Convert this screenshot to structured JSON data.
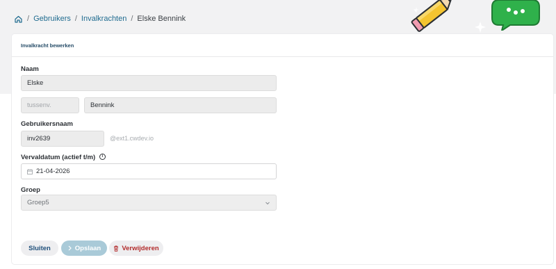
{
  "breadcrumb": {
    "home_icon": "home-icon",
    "items": [
      "Gebruikers",
      "Invalkrachten"
    ],
    "current": "Elske Bennink",
    "separator": "/"
  },
  "card": {
    "title": "Invalkracht bewerken"
  },
  "form": {
    "naam_label": "Naam",
    "voornaam_value": "Elske",
    "tussenvoegsel_placeholder": "tussenv.",
    "achternaam_value": "Bennink",
    "gebruikersnaam_label": "Gebruikersnaam",
    "gebruikersnaam_value": "inv2639",
    "gebruikersnaam_suffix": "@ext1.cwdev.io",
    "vervaldatum_label": "Vervaldatum (actief t/m)",
    "vervaldatum_value": "21-04-2026",
    "groep_label": "Groep",
    "groep_value": "Groep5"
  },
  "buttons": {
    "sluiten": "Sluiten",
    "opslaan": "Opslaan",
    "verwijderen": "Verwijderen"
  },
  "colors": {
    "link": "#1f6b8f",
    "danger": "#b22b2b",
    "primary_disabled": "#a9cad8",
    "pencil_yellow": "#f4c430",
    "chat_green": "#2fb14b"
  }
}
